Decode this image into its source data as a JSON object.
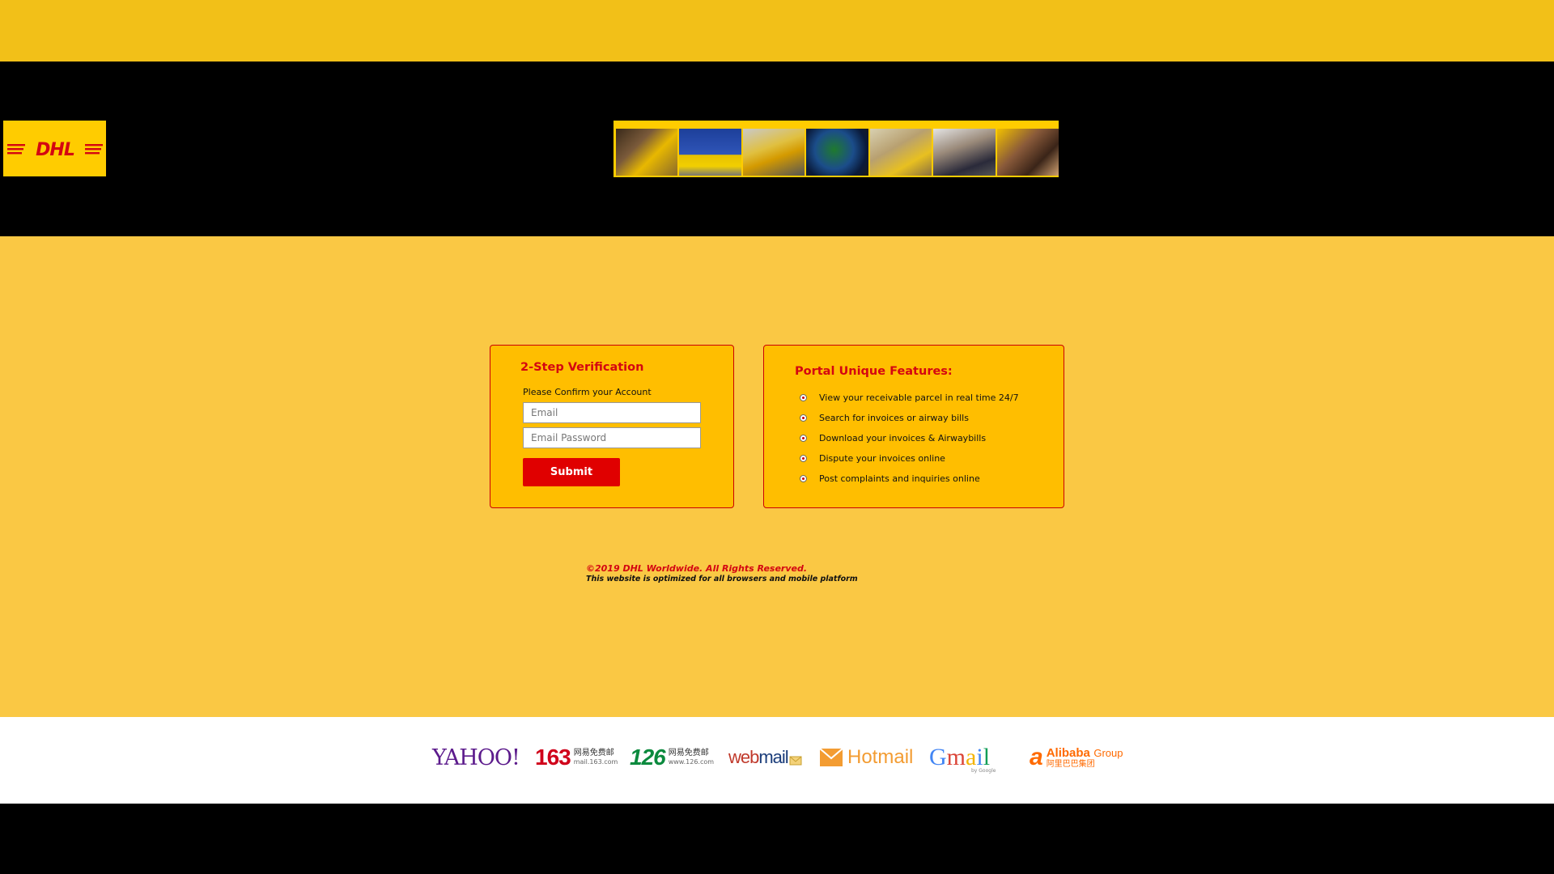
{
  "header": {
    "logo_text": "DHL",
    "banner_images": [
      "courier-with-parcel",
      "dhl-van-eu-flag",
      "dhl-airplane",
      "globe",
      "warehouse-worker",
      "office-team",
      "customer-service-agent"
    ]
  },
  "verification": {
    "title": "2-Step Verification",
    "prompt": "Please Confirm your Account",
    "email_placeholder": "Email",
    "password_placeholder": "Email Password",
    "submit_label": "Submit"
  },
  "features": {
    "title": "Portal Unique Features:",
    "items": [
      "View your receivable parcel in real time 24/7",
      "Search for invoices or airway bills",
      "Download your invoices & Airwaybills",
      "Dispute your invoices online",
      "Post complaints and inquiries online"
    ]
  },
  "footer_text": {
    "copyright": "©2019 DHL Worldwide. All Rights Reserved.",
    "optimized": "This website is optimized for all browsers and mobile platform"
  },
  "mail_providers": {
    "yahoo": "YAHOO!",
    "n163": "163",
    "n163_cn": "网易免费邮",
    "n163_url": "mail.163.com",
    "n126": "126",
    "n126_cn": "网易免费邮",
    "n126_url": "www.126.com",
    "webmail_a": "web",
    "webmail_b": "mail",
    "hotmail": "Hotmail",
    "gmail": "Gmail",
    "alibaba": "Alibaba",
    "alibaba_group": "Group",
    "alibaba_cn": "阿里巴巴集团"
  },
  "colors": {
    "dhl_yellow": "#ffcc00",
    "dhl_red": "#d40511",
    "page_background": "#fac844"
  }
}
